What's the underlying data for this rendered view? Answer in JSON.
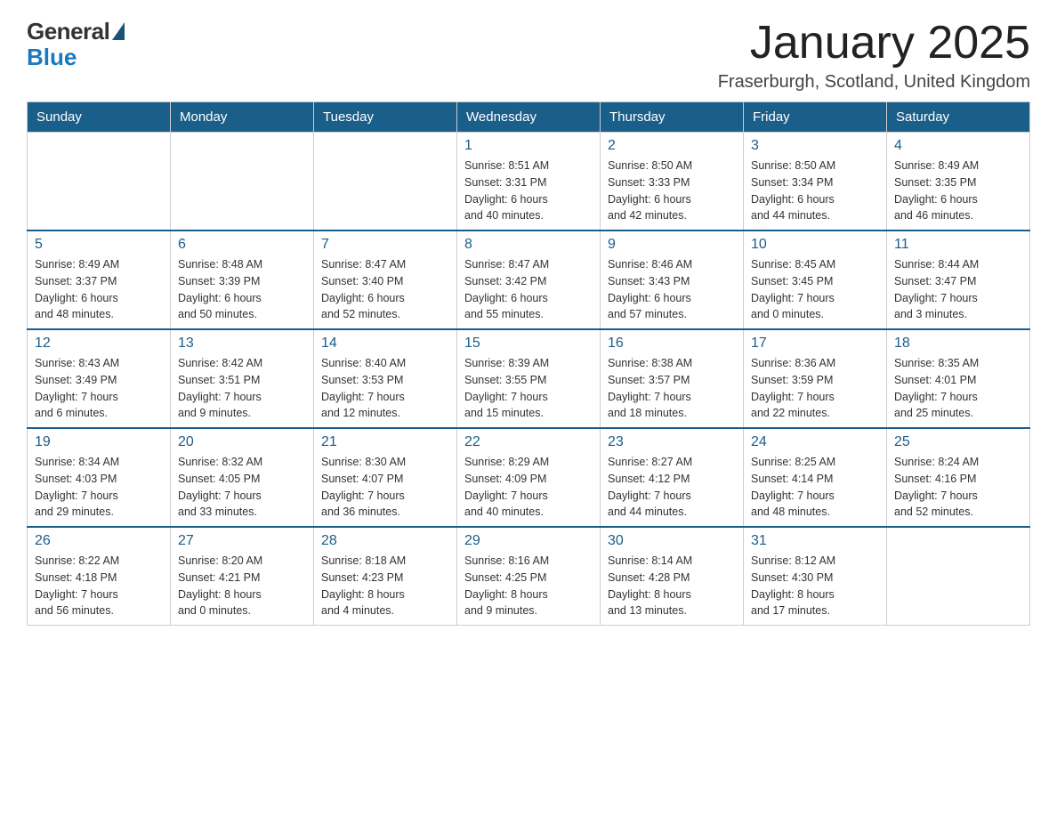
{
  "header": {
    "logo_general": "General",
    "logo_blue": "Blue",
    "month_title": "January 2025",
    "location": "Fraserburgh, Scotland, United Kingdom"
  },
  "days_of_week": [
    "Sunday",
    "Monday",
    "Tuesday",
    "Wednesday",
    "Thursday",
    "Friday",
    "Saturday"
  ],
  "weeks": [
    [
      {
        "day": "",
        "info": ""
      },
      {
        "day": "",
        "info": ""
      },
      {
        "day": "",
        "info": ""
      },
      {
        "day": "1",
        "info": "Sunrise: 8:51 AM\nSunset: 3:31 PM\nDaylight: 6 hours\nand 40 minutes."
      },
      {
        "day": "2",
        "info": "Sunrise: 8:50 AM\nSunset: 3:33 PM\nDaylight: 6 hours\nand 42 minutes."
      },
      {
        "day": "3",
        "info": "Sunrise: 8:50 AM\nSunset: 3:34 PM\nDaylight: 6 hours\nand 44 minutes."
      },
      {
        "day": "4",
        "info": "Sunrise: 8:49 AM\nSunset: 3:35 PM\nDaylight: 6 hours\nand 46 minutes."
      }
    ],
    [
      {
        "day": "5",
        "info": "Sunrise: 8:49 AM\nSunset: 3:37 PM\nDaylight: 6 hours\nand 48 minutes."
      },
      {
        "day": "6",
        "info": "Sunrise: 8:48 AM\nSunset: 3:39 PM\nDaylight: 6 hours\nand 50 minutes."
      },
      {
        "day": "7",
        "info": "Sunrise: 8:47 AM\nSunset: 3:40 PM\nDaylight: 6 hours\nand 52 minutes."
      },
      {
        "day": "8",
        "info": "Sunrise: 8:47 AM\nSunset: 3:42 PM\nDaylight: 6 hours\nand 55 minutes."
      },
      {
        "day": "9",
        "info": "Sunrise: 8:46 AM\nSunset: 3:43 PM\nDaylight: 6 hours\nand 57 minutes."
      },
      {
        "day": "10",
        "info": "Sunrise: 8:45 AM\nSunset: 3:45 PM\nDaylight: 7 hours\nand 0 minutes."
      },
      {
        "day": "11",
        "info": "Sunrise: 8:44 AM\nSunset: 3:47 PM\nDaylight: 7 hours\nand 3 minutes."
      }
    ],
    [
      {
        "day": "12",
        "info": "Sunrise: 8:43 AM\nSunset: 3:49 PM\nDaylight: 7 hours\nand 6 minutes."
      },
      {
        "day": "13",
        "info": "Sunrise: 8:42 AM\nSunset: 3:51 PM\nDaylight: 7 hours\nand 9 minutes."
      },
      {
        "day": "14",
        "info": "Sunrise: 8:40 AM\nSunset: 3:53 PM\nDaylight: 7 hours\nand 12 minutes."
      },
      {
        "day": "15",
        "info": "Sunrise: 8:39 AM\nSunset: 3:55 PM\nDaylight: 7 hours\nand 15 minutes."
      },
      {
        "day": "16",
        "info": "Sunrise: 8:38 AM\nSunset: 3:57 PM\nDaylight: 7 hours\nand 18 minutes."
      },
      {
        "day": "17",
        "info": "Sunrise: 8:36 AM\nSunset: 3:59 PM\nDaylight: 7 hours\nand 22 minutes."
      },
      {
        "day": "18",
        "info": "Sunrise: 8:35 AM\nSunset: 4:01 PM\nDaylight: 7 hours\nand 25 minutes."
      }
    ],
    [
      {
        "day": "19",
        "info": "Sunrise: 8:34 AM\nSunset: 4:03 PM\nDaylight: 7 hours\nand 29 minutes."
      },
      {
        "day": "20",
        "info": "Sunrise: 8:32 AM\nSunset: 4:05 PM\nDaylight: 7 hours\nand 33 minutes."
      },
      {
        "day": "21",
        "info": "Sunrise: 8:30 AM\nSunset: 4:07 PM\nDaylight: 7 hours\nand 36 minutes."
      },
      {
        "day": "22",
        "info": "Sunrise: 8:29 AM\nSunset: 4:09 PM\nDaylight: 7 hours\nand 40 minutes."
      },
      {
        "day": "23",
        "info": "Sunrise: 8:27 AM\nSunset: 4:12 PM\nDaylight: 7 hours\nand 44 minutes."
      },
      {
        "day": "24",
        "info": "Sunrise: 8:25 AM\nSunset: 4:14 PM\nDaylight: 7 hours\nand 48 minutes."
      },
      {
        "day": "25",
        "info": "Sunrise: 8:24 AM\nSunset: 4:16 PM\nDaylight: 7 hours\nand 52 minutes."
      }
    ],
    [
      {
        "day": "26",
        "info": "Sunrise: 8:22 AM\nSunset: 4:18 PM\nDaylight: 7 hours\nand 56 minutes."
      },
      {
        "day": "27",
        "info": "Sunrise: 8:20 AM\nSunset: 4:21 PM\nDaylight: 8 hours\nand 0 minutes."
      },
      {
        "day": "28",
        "info": "Sunrise: 8:18 AM\nSunset: 4:23 PM\nDaylight: 8 hours\nand 4 minutes."
      },
      {
        "day": "29",
        "info": "Sunrise: 8:16 AM\nSunset: 4:25 PM\nDaylight: 8 hours\nand 9 minutes."
      },
      {
        "day": "30",
        "info": "Sunrise: 8:14 AM\nSunset: 4:28 PM\nDaylight: 8 hours\nand 13 minutes."
      },
      {
        "day": "31",
        "info": "Sunrise: 8:12 AM\nSunset: 4:30 PM\nDaylight: 8 hours\nand 17 minutes."
      },
      {
        "day": "",
        "info": ""
      }
    ]
  ]
}
